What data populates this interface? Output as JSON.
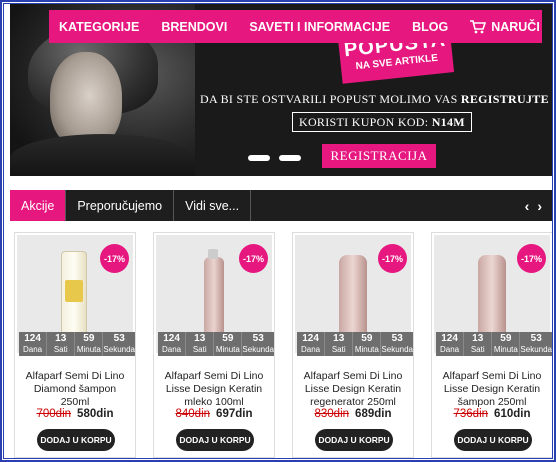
{
  "nav": {
    "items": [
      "KATEGORIJE",
      "BRENDOVI",
      "SAVETI I INFORMACIJE",
      "BLOG"
    ],
    "cart_label": "NARUČI"
  },
  "banner": {
    "promo_line1": "POPUSTA",
    "promo_line2": "NA SVE ARTIKLE",
    "text_prefix": "DA BI STE OSTVARILI POPUST MOLIMO VAS",
    "text_bold": "REGISTRUJTE SE",
    "coupon_prefix": "KORISTI KUPON KOD:",
    "coupon_code": "N14M",
    "register_label": "REGISTRACIJA"
  },
  "tabs": [
    "Akcije",
    "Preporučujemo",
    "Vidi sve..."
  ],
  "arrows": {
    "prev": "‹",
    "next": "›"
  },
  "products": [
    {
      "discount": "-17%",
      "days": "124",
      "hours": "13",
      "minutes": "59",
      "seconds": "53",
      "name": "Alfaparf Semi Di Lino Diamond šampon 250ml",
      "old_price": "700din",
      "new_price": "580din",
      "buy_label": "DODAJ U KORPU",
      "bottle": "yellow"
    },
    {
      "discount": "-17%",
      "days": "124",
      "hours": "13",
      "minutes": "59",
      "seconds": "53",
      "name": "Alfaparf Semi Di Lino Lisse Design Keratin mleko 100ml",
      "old_price": "840din",
      "new_price": "697din",
      "buy_label": "DODAJ U KORPU",
      "bottle": "spray"
    },
    {
      "discount": "-17%",
      "days": "124",
      "hours": "13",
      "minutes": "59",
      "seconds": "53",
      "name": "Alfaparf Semi Di Lino Lisse Design Keratin regenerator 250ml",
      "old_price": "830din",
      "new_price": "689din",
      "buy_label": "DODAJ U KORPU",
      "bottle": "pink"
    },
    {
      "discount": "-17%",
      "days": "124",
      "hours": "13",
      "minutes": "59",
      "seconds": "53",
      "name": "Alfaparf Semi Di Lino Lisse Design Keratin šampon 250ml",
      "old_price": "736din",
      "new_price": "610din",
      "buy_label": "DODAJ U KORPU",
      "bottle": "pink"
    }
  ],
  "countdown_labels": [
    "Dana",
    "Sati",
    "Minuta",
    "Sekunda"
  ],
  "colors": {
    "accent": "#e6177f",
    "dark": "#1e1e1e"
  }
}
